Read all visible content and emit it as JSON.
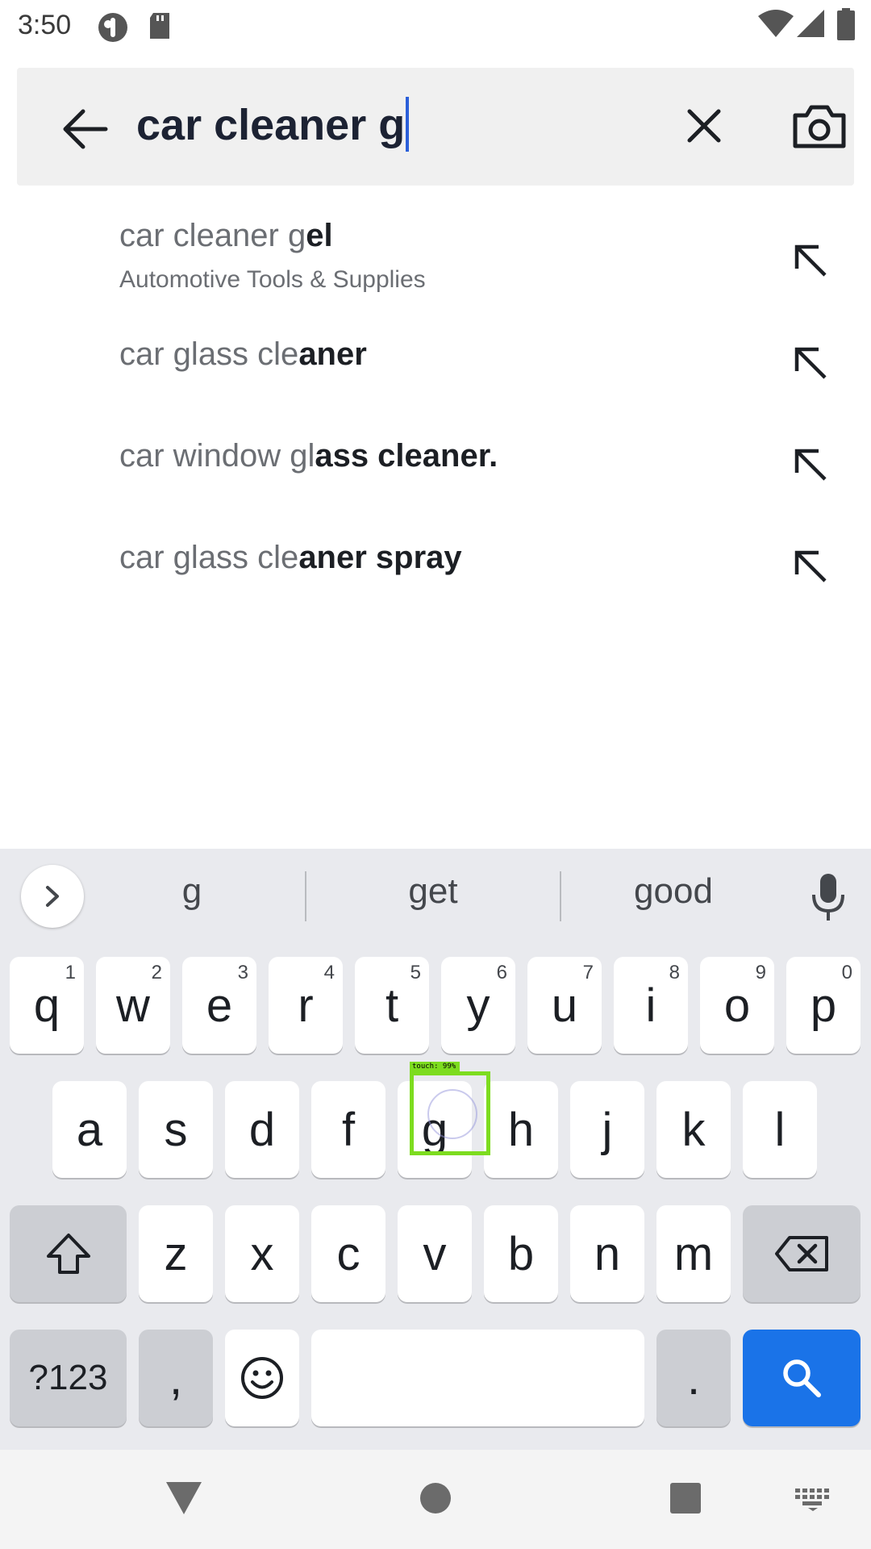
{
  "status_bar": {
    "time": "3:50",
    "icons": [
      "notification-app-icon",
      "sd-card-icon",
      "wifi-icon",
      "signal-icon",
      "battery-icon"
    ]
  },
  "search": {
    "query": "car cleaner g",
    "back_icon": "arrow-left-icon",
    "clear_icon": "close-icon",
    "camera_icon": "camera-icon"
  },
  "suggestions": [
    {
      "prefix": "car cleaner g",
      "bold": "el",
      "category": "Automotive Tools & Supplies"
    },
    {
      "prefix": "car glass cle",
      "bold": "aner",
      "category": ""
    },
    {
      "prefix": "car window gl",
      "bold": "ass cleaner.",
      "category": ""
    },
    {
      "prefix": "car glass cle",
      "bold": "aner spray",
      "category": ""
    }
  ],
  "keyboard": {
    "word_suggestions": [
      "g",
      "get",
      "good"
    ],
    "row1": [
      {
        "key": "q",
        "hint": "1"
      },
      {
        "key": "w",
        "hint": "2"
      },
      {
        "key": "e",
        "hint": "3"
      },
      {
        "key": "r",
        "hint": "4"
      },
      {
        "key": "t",
        "hint": "5"
      },
      {
        "key": "y",
        "hint": "6"
      },
      {
        "key": "u",
        "hint": "7"
      },
      {
        "key": "i",
        "hint": "8"
      },
      {
        "key": "o",
        "hint": "9"
      },
      {
        "key": "p",
        "hint": "0"
      }
    ],
    "row2": [
      "a",
      "s",
      "d",
      "f",
      "g",
      "h",
      "j",
      "k",
      "l"
    ],
    "row3": [
      "z",
      "x",
      "c",
      "v",
      "b",
      "n",
      "m"
    ],
    "symbols_label": "?123",
    "comma_label": ",",
    "period_label": ".",
    "accent_color": "#1a73e8"
  },
  "touch_overlay": {
    "label": "touch: 99%",
    "color": "#7ddc1f"
  },
  "nav_bar": {
    "icons": [
      "back-triangle-icon",
      "home-circle-icon",
      "recents-square-icon",
      "keyboard-switch-icon"
    ]
  }
}
